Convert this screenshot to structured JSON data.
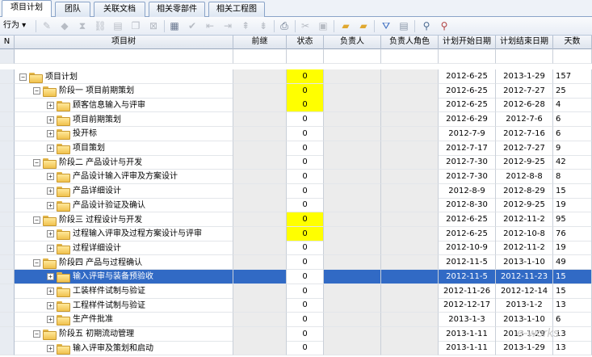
{
  "tabs": [
    {
      "label": "项目计划",
      "active": true
    },
    {
      "label": "团队",
      "active": false
    },
    {
      "label": "关联文档",
      "active": false
    },
    {
      "label": "相关零部件",
      "active": false
    },
    {
      "label": "相关工程图",
      "active": false
    }
  ],
  "toolbar": {
    "menu_label": "行为 ▾",
    "icons": [
      "edit-icon",
      "link-icon",
      "hourglass-icon",
      "chain-icon",
      "chart-icon",
      "copy-icon",
      "delete-icon",
      "grid-icon",
      "check-icon",
      "outdent-icon",
      "indent-icon",
      "move-up-icon",
      "move-down-icon",
      "print-icon",
      "cut-icon",
      "paste-icon",
      "folder-open-icon",
      "folder-icon",
      "filter-icon",
      "export-icon",
      "search-icon",
      "clear-search-icon"
    ]
  },
  "columns": {
    "n": "N",
    "name": "项目树",
    "pred": "前继",
    "status": "状态",
    "owner": "负责人",
    "role": "负责人角色",
    "start": "计划开始日期",
    "end": "计划结束日期",
    "days": "天数"
  },
  "rows": [
    {
      "level": 0,
      "toggle": "−",
      "name": "项目计划",
      "status": "0",
      "yellow": true,
      "start": "2012-6-25",
      "end": "2013-1-29",
      "days": "157",
      "selected": false
    },
    {
      "level": 1,
      "toggle": "−",
      "name": "阶段一 项目前期策划",
      "status": "0",
      "yellow": true,
      "start": "2012-6-25",
      "end": "2012-7-27",
      "days": "25",
      "selected": false
    },
    {
      "level": 2,
      "toggle": "+",
      "name": "顾客信息输入与评审",
      "status": "0",
      "yellow": true,
      "start": "2012-6-25",
      "end": "2012-6-28",
      "days": "4",
      "selected": false
    },
    {
      "level": 2,
      "toggle": "+",
      "name": "项目前期策划",
      "status": "0",
      "yellow": false,
      "start": "2012-6-29",
      "end": "2012-7-6",
      "days": "6",
      "selected": false
    },
    {
      "level": 2,
      "toggle": "+",
      "name": "投开标",
      "status": "0",
      "yellow": false,
      "start": "2012-7-9",
      "end": "2012-7-16",
      "days": "6",
      "selected": false
    },
    {
      "level": 2,
      "toggle": "+",
      "name": "项目策划",
      "status": "0",
      "yellow": false,
      "start": "2012-7-17",
      "end": "2012-7-27",
      "days": "9",
      "selected": false
    },
    {
      "level": 1,
      "toggle": "−",
      "name": "阶段二 产品设计与开发",
      "status": "0",
      "yellow": false,
      "start": "2012-7-30",
      "end": "2012-9-25",
      "days": "42",
      "selected": false
    },
    {
      "level": 2,
      "toggle": "+",
      "name": "产品设计输入评审及方案设计",
      "status": "0",
      "yellow": false,
      "start": "2012-7-30",
      "end": "2012-8-8",
      "days": "8",
      "selected": false
    },
    {
      "level": 2,
      "toggle": "+",
      "name": "产品详细设计",
      "status": "0",
      "yellow": false,
      "start": "2012-8-9",
      "end": "2012-8-29",
      "days": "15",
      "selected": false
    },
    {
      "level": 2,
      "toggle": "+",
      "name": "产品设计验证及确认",
      "status": "0",
      "yellow": false,
      "start": "2012-8-30",
      "end": "2012-9-25",
      "days": "19",
      "selected": false
    },
    {
      "level": 1,
      "toggle": "−",
      "name": "阶段三 过程设计与开发",
      "status": "0",
      "yellow": true,
      "start": "2012-6-25",
      "end": "2012-11-2",
      "days": "95",
      "selected": false
    },
    {
      "level": 2,
      "toggle": "+",
      "name": "过程输入评审及过程方案设计与评审",
      "status": "0",
      "yellow": true,
      "start": "2012-6-25",
      "end": "2012-10-8",
      "days": "76",
      "selected": false
    },
    {
      "level": 2,
      "toggle": "+",
      "name": "过程详细设计",
      "status": "0",
      "yellow": false,
      "start": "2012-10-9",
      "end": "2012-11-2",
      "days": "19",
      "selected": false
    },
    {
      "level": 1,
      "toggle": "−",
      "name": "阶段四 产品与过程确认",
      "status": "0",
      "yellow": false,
      "start": "2012-11-5",
      "end": "2013-1-10",
      "days": "49",
      "selected": false
    },
    {
      "level": 2,
      "toggle": "+",
      "name": "输入评审与装备预验收",
      "status": "0",
      "yellow": false,
      "start": "2012-11-5",
      "end": "2012-11-23",
      "days": "15",
      "selected": true
    },
    {
      "level": 2,
      "toggle": "+",
      "name": "工装样件试制与验证",
      "status": "0",
      "yellow": false,
      "start": "2012-11-26",
      "end": "2012-12-14",
      "days": "15",
      "selected": false
    },
    {
      "level": 2,
      "toggle": "+",
      "name": "工程样件试制与验证",
      "status": "0",
      "yellow": false,
      "start": "2012-12-17",
      "end": "2013-1-2",
      "days": "13",
      "selected": false
    },
    {
      "level": 2,
      "toggle": "+",
      "name": "生产件批准",
      "status": "0",
      "yellow": false,
      "start": "2013-1-3",
      "end": "2013-1-10",
      "days": "6",
      "selected": false
    },
    {
      "level": 1,
      "toggle": "−",
      "name": "阶段五 初期流动管理",
      "status": "0",
      "yellow": false,
      "start": "2013-1-11",
      "end": "2013-1-29",
      "days": "13",
      "selected": false
    },
    {
      "level": 2,
      "toggle": "+",
      "name": "输入评审及策划和启动",
      "status": "0",
      "yellow": false,
      "start": "2013-1-11",
      "end": "2013-1-29",
      "days": "13",
      "selected": false
    }
  ],
  "watermark": "e-works"
}
